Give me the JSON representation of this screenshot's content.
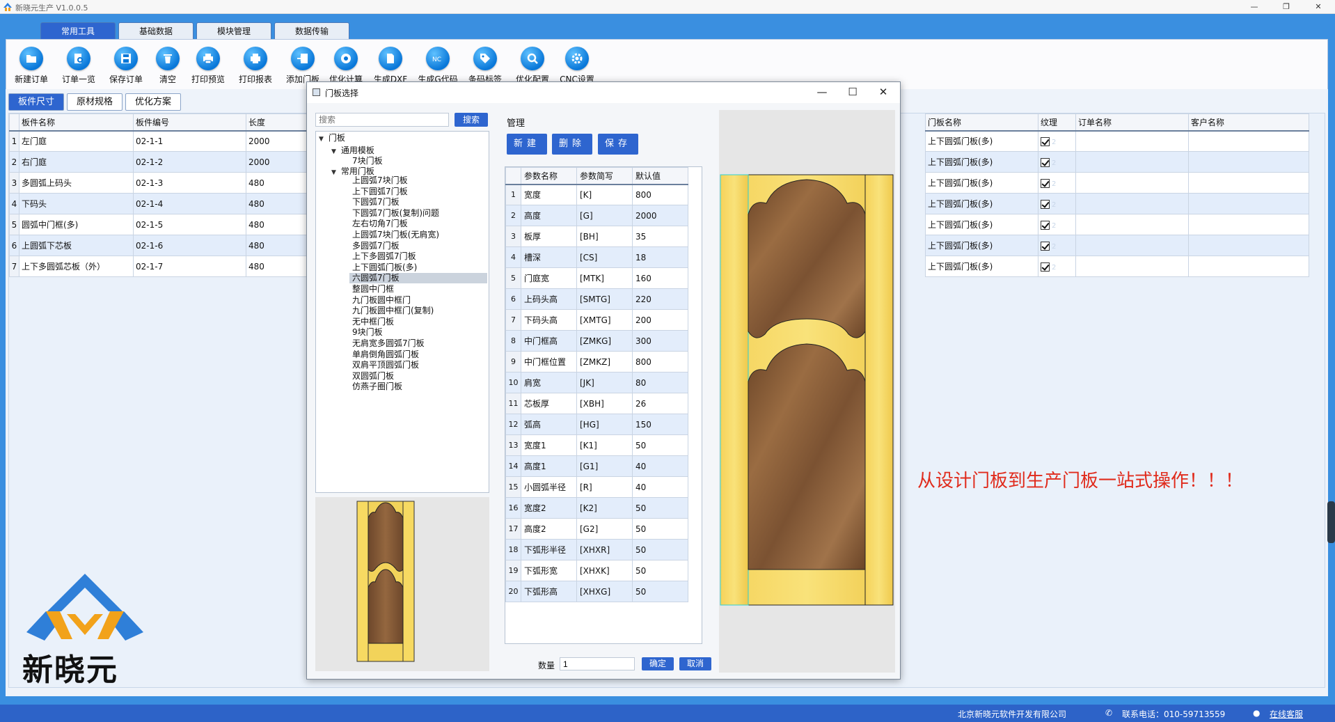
{
  "app": {
    "title": "新晓元生产 V1.0.0.5"
  },
  "menu_tabs": [
    "常用工具",
    "基础数据",
    "模块管理",
    "数据传输"
  ],
  "toolbar": [
    "新建订单",
    "订单一览",
    "保存订单",
    "清空",
    "打印预览",
    "打印报表",
    "添加门板",
    "优化计算",
    "生成DXF",
    "生成G代码",
    "条码标签",
    "优化配置",
    "CNC设置"
  ],
  "sub_tabs": [
    "板件尺寸",
    "原材规格",
    "优化方案"
  ],
  "left_grid": {
    "headers": [
      "板件名称",
      "板件编号",
      "长度"
    ],
    "rows": [
      {
        "n": "1",
        "name": "左门庭",
        "code": "02-1-1",
        "len": "2000"
      },
      {
        "n": "2",
        "name": "右门庭",
        "code": "02-1-2",
        "len": "2000"
      },
      {
        "n": "3",
        "name": "多圆弧上码头",
        "code": "02-1-3",
        "len": "480"
      },
      {
        "n": "4",
        "name": "下码头",
        "code": "02-1-4",
        "len": "480"
      },
      {
        "n": "5",
        "name": "圆弧中门框(多)",
        "code": "02-1-5",
        "len": "480"
      },
      {
        "n": "6",
        "name": "上圆弧下芯板",
        "code": "02-1-6",
        "len": "480"
      },
      {
        "n": "7",
        "name": "上下多圆弧芯板（外）",
        "code": "02-1-7",
        "len": "480"
      }
    ]
  },
  "right_grid": {
    "headers": [
      "门板名称",
      "纹理",
      "订单名称",
      "客户名称"
    ],
    "door_name": "上下圆弧门板(多)",
    "ghost": "2"
  },
  "dialog": {
    "title": "门板选择",
    "search_placeholder": "搜索",
    "search_button": "搜索",
    "tree": {
      "root": "门板",
      "group1": "通用模板",
      "group1_items": [
        "7块门板"
      ],
      "group2": "常用门板",
      "group2_items": [
        "上圆弧7块门板",
        "上下圆弧7门板",
        "下圆弧7门板",
        "下圆弧7门板(复制)问题",
        "左右切角7门板",
        "上圆弧7块门板(无肩宽)",
        "多圆弧7门板",
        "上下多圆弧7门板",
        "上下圆弧门板(多)",
        "六圆弧7门板",
        "整圆中门框",
        "九门板圆中框门",
        "九门板圆中框门(复制)",
        "无中框门板",
        "9块门板",
        "无肩宽多圆弧7门板",
        "单肩倒角圆弧门板",
        "双肩平顶圆弧门板",
        "双圆弧门板",
        "仿燕子圈门板"
      ],
      "selected": "六圆弧7门板"
    },
    "mgmt_label": "管理",
    "buttons": {
      "new": "新建",
      "delete": "删除",
      "save": "保存"
    },
    "param_headers": [
      "参数名称",
      "参数简写",
      "默认值"
    ],
    "params": [
      {
        "n": "1",
        "name": "宽度",
        "abbr": "[K]",
        "val": "800"
      },
      {
        "n": "2",
        "name": "高度",
        "abbr": "[G]",
        "val": "2000"
      },
      {
        "n": "3",
        "name": "板厚",
        "abbr": "[BH]",
        "val": "35"
      },
      {
        "n": "4",
        "name": "槽深",
        "abbr": "[CS]",
        "val": "18"
      },
      {
        "n": "5",
        "name": "门庭宽",
        "abbr": "[MTK]",
        "val": "160"
      },
      {
        "n": "6",
        "name": "上码头高",
        "abbr": "[SMTG]",
        "val": "220"
      },
      {
        "n": "7",
        "name": "下码头高",
        "abbr": "[XMTG]",
        "val": "200"
      },
      {
        "n": "8",
        "name": "中门框高",
        "abbr": "[ZMKG]",
        "val": "300"
      },
      {
        "n": "9",
        "name": "中门框位置",
        "abbr": "[ZMKZ]",
        "val": "800"
      },
      {
        "n": "10",
        "name": "肩宽",
        "abbr": "[JK]",
        "val": "80"
      },
      {
        "n": "11",
        "name": "芯板厚",
        "abbr": "[XBH]",
        "val": "26"
      },
      {
        "n": "12",
        "name": "弧高",
        "abbr": "[HG]",
        "val": "150"
      },
      {
        "n": "13",
        "name": "宽度1",
        "abbr": "[K1]",
        "val": "50"
      },
      {
        "n": "14",
        "name": "高度1",
        "abbr": "[G1]",
        "val": "40"
      },
      {
        "n": "15",
        "name": "小圆弧半径",
        "abbr": "[R]",
        "val": "40"
      },
      {
        "n": "16",
        "name": "宽度2",
        "abbr": "[K2]",
        "val": "50"
      },
      {
        "n": "17",
        "name": "高度2",
        "abbr": "[G2]",
        "val": "50"
      },
      {
        "n": "18",
        "name": "下弧形半径",
        "abbr": "[XHXR]",
        "val": "50"
      },
      {
        "n": "19",
        "name": "下弧形宽",
        "abbr": "[XHXK]",
        "val": "50"
      },
      {
        "n": "20",
        "name": "下弧形高",
        "abbr": "[XHXG]",
        "val": "50"
      }
    ],
    "qty_label": "数量",
    "qty_value": "1",
    "ok": "确定",
    "cancel": "取消"
  },
  "slogan": "从设计门板到生产门板一站式操作！！！",
  "logo_text": "新晓元",
  "status": {
    "company": "北京新晓元软件开发有限公司",
    "phone": "联系电话：010-59713559",
    "service": "在线客服"
  },
  "colors": {
    "accent": "#2e65cf",
    "frame": "#3a8fe0",
    "wood_light": "#f2d35a",
    "wood_dark": "#7a5232",
    "slogan": "#e02b1c"
  }
}
